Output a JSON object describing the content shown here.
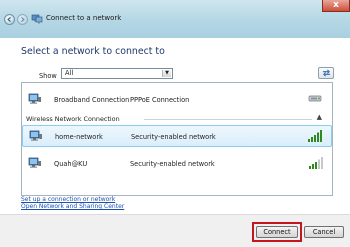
{
  "window": {
    "title": "Connect to a network",
    "close_label": "x"
  },
  "heading": "Select a network to connect to",
  "filter": {
    "label": "Show",
    "selected": "All"
  },
  "networks": [
    {
      "name": "Broadband Connection",
      "status": "PPPoE Connection",
      "type": "wired",
      "signal_bars": 0,
      "selected": false
    },
    {
      "name": "home-network",
      "status": "Security-enabled network",
      "type": "wireless",
      "signal_bars": 5,
      "selected": true
    },
    {
      "name": "Quah@KU",
      "status": "Security-enabled network",
      "type": "wireless",
      "signal_bars": 3,
      "selected": false
    }
  ],
  "group": {
    "label": "Wireless Network Connection"
  },
  "links": {
    "setup": "Set up a connection or network",
    "sharing_center": "Open Network and Sharing Center"
  },
  "buttons": {
    "connect": "Connect",
    "cancel": "Cancel"
  },
  "colors": {
    "heading": "#1d3a6b",
    "link": "#1a4fb3",
    "selection": "#d9eefb",
    "highlight": "#c4161c",
    "signal_on": "#2e8b1e"
  },
  "icons": {
    "back": "back-arrow-icon",
    "forward": "forward-arrow-icon",
    "title": "network-icon",
    "refresh": "refresh-icon",
    "computer": "network-computer-icon",
    "signal": "signal-strength-icon"
  }
}
